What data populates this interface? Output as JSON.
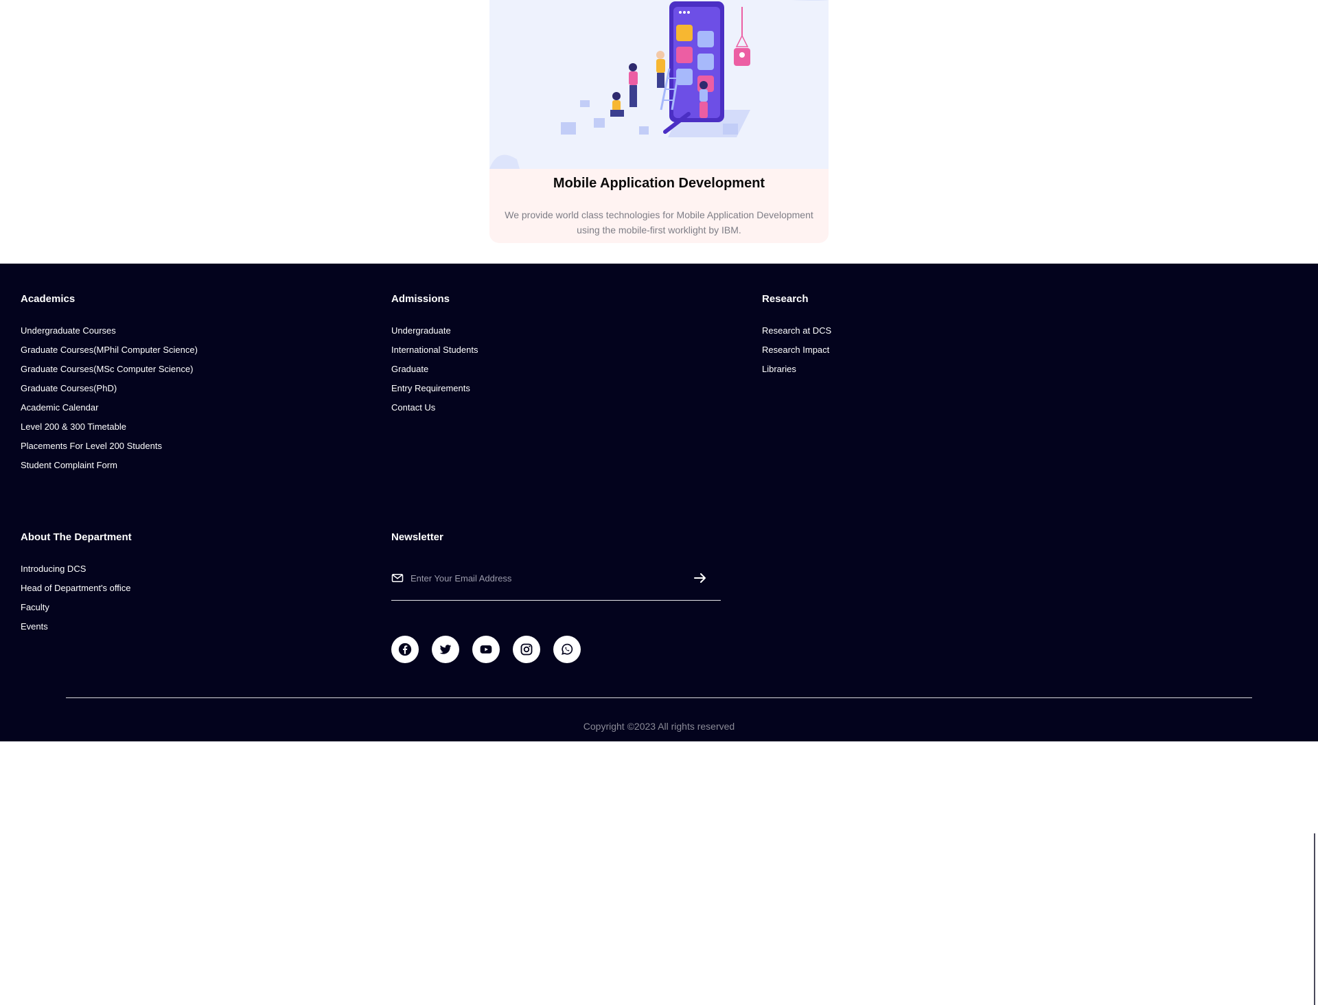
{
  "card": {
    "title": "Mobile Application Development",
    "description": "We provide world class technologies for Mobile Application Development using the mobile-first worklight by IBM."
  },
  "footer": {
    "academics": {
      "heading": "Academics",
      "links": [
        "Undergraduate Courses",
        "Graduate Courses(MPhil Computer Science)",
        "Graduate Courses(MSc Computer Science)",
        "Graduate Courses(PhD)",
        "Academic Calendar",
        "Level 200 & 300 Timetable",
        "Placements For Level 200 Students",
        "Student Complaint Form"
      ]
    },
    "admissions": {
      "heading": "Admissions",
      "links": [
        "Undergraduate",
        "International Students",
        "Graduate",
        "Entry Requirements",
        "Contact Us"
      ]
    },
    "research": {
      "heading": "Research",
      "links": [
        "Research at DCS",
        "Research Impact",
        "Libraries"
      ]
    },
    "about": {
      "heading": "About The Department",
      "links": [
        "Introducing DCS",
        "Head of Department's office",
        "Faculty",
        "Events"
      ]
    },
    "newsletter": {
      "heading": "Newsletter",
      "placeholder": "Enter Your Email Address",
      "mail_icon": "envelope-icon",
      "submit_icon": "arrow-right-icon"
    },
    "social_icons": [
      "facebook-icon",
      "twitter-icon",
      "youtube-icon",
      "instagram-icon",
      "whatsapp-icon"
    ],
    "copyright": "Copyright ©2023 All rights reserved"
  },
  "colors": {
    "footer_bg": "#03031d",
    "card_bg": "#fff3f2",
    "illustration_bg": "#eef2fd",
    "accent_purple": "#5b3ad6",
    "accent_pink": "#ec5ea3"
  }
}
